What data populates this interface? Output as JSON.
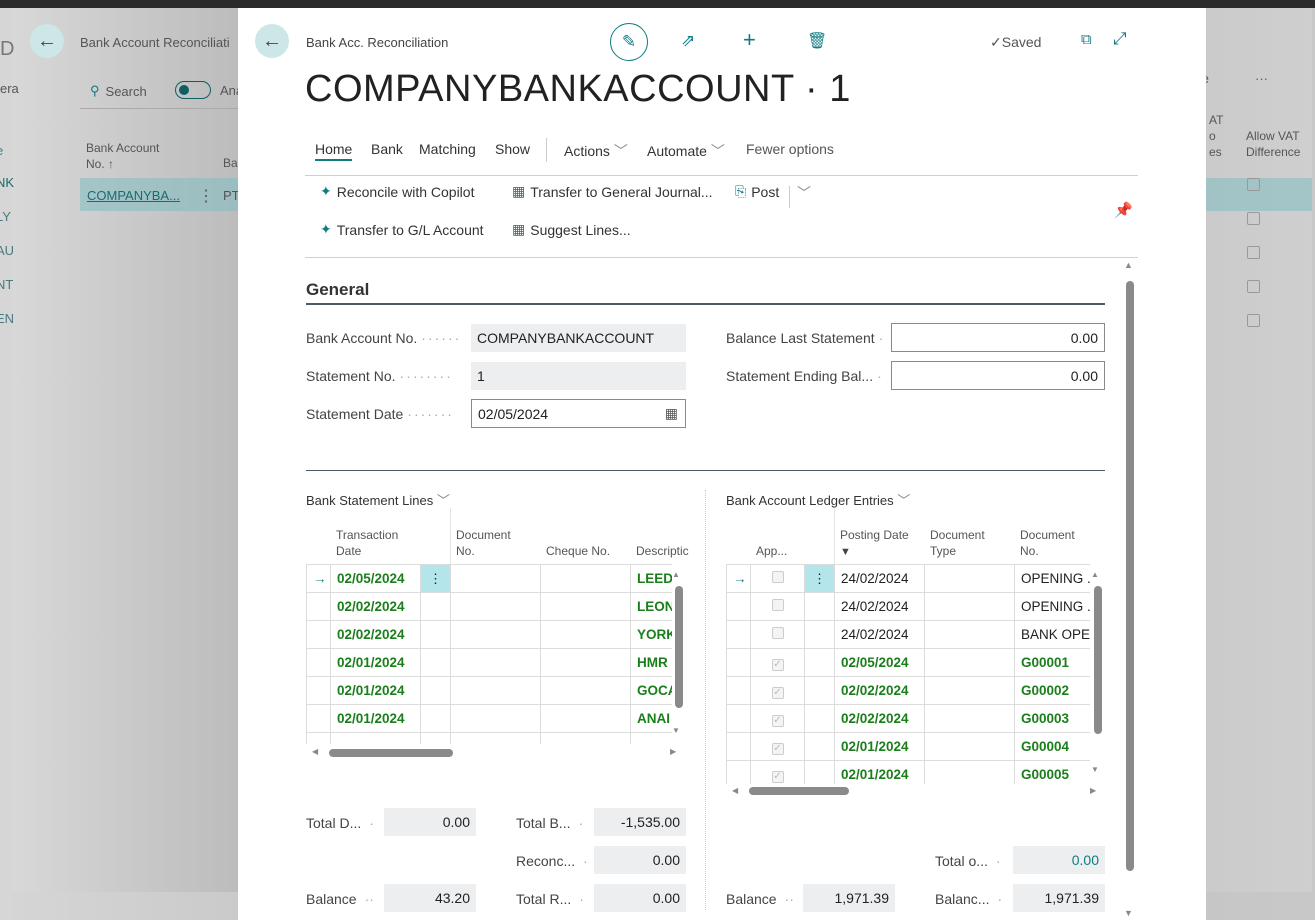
{
  "background": {
    "app_letter": "D",
    "page_title": "Bank Account Reconciliati",
    "search_label": "Search",
    "toggle_label": "Ana",
    "left_tab": "era",
    "col1": "Bank Account\nNo. ↑",
    "col2": "Ba",
    "row_value": "COMPANYBA...",
    "row_col2": "PT",
    "left_items": [
      "e",
      "NK",
      "LY",
      "AU",
      "NT",
      "EN"
    ],
    "right_action": "te",
    "more": "···",
    "col_vat": "AT\no\nes",
    "col_allow": "Allow VAT\nDifference"
  },
  "header": {
    "breadcrumb": "Bank Acc. Reconciliation",
    "title": "COMPANYBANKACCOUNT · 1",
    "saved": "Saved"
  },
  "tabs": [
    "Home",
    "Bank",
    "Matching",
    "Show",
    "Actions",
    "Automate",
    "Fewer options"
  ],
  "actions": {
    "reconcile": "Reconcile with Copilot",
    "transfer_journal": "Transfer to General Journal...",
    "post": "Post",
    "transfer_gl": "Transfer to G/L Account",
    "suggest": "Suggest Lines..."
  },
  "general": {
    "title": "General",
    "bank_account_label": "Bank Account No.",
    "bank_account": "COMPANYBANKACCOUNT",
    "statement_no_label": "Statement No.",
    "statement_no": "1",
    "statement_date_label": "Statement Date",
    "statement_date": "02/05/2024",
    "balance_last_label": "Balance Last Statement",
    "balance_last": "0.00",
    "ending_balance_label": "Statement Ending Bal...",
    "ending_balance": "0.00"
  },
  "statement_lines": {
    "title": "Bank Statement Lines",
    "headers": [
      "Transaction\nDate",
      "Document\nNo.",
      "Cheque No.",
      "Descriptic"
    ],
    "rows": [
      [
        "02/05/2024",
        "",
        "",
        "LEEDS"
      ],
      [
        "02/02/2024",
        "",
        "",
        "LEON"
      ],
      [
        "02/02/2024",
        "",
        "",
        "YORK"
      ],
      [
        "02/01/2024",
        "",
        "",
        "HMR"
      ],
      [
        "02/01/2024",
        "",
        "",
        "GOCA"
      ],
      [
        "02/01/2024",
        "",
        "",
        "ANAI"
      ]
    ]
  },
  "ledger_entries": {
    "title": "Bank Account Ledger Entries",
    "headers": [
      "App...",
      "Posting Date",
      "Document\nType",
      "Document\nNo."
    ],
    "rows": [
      {
        "applied": false,
        "date": "24/02/2024",
        "type": "",
        "doc": "OPENING ..",
        "bold": false
      },
      {
        "applied": false,
        "date": "24/02/2024",
        "type": "",
        "doc": "OPENING ..",
        "bold": false
      },
      {
        "applied": false,
        "date": "24/02/2024",
        "type": "",
        "doc": "BANK OPE.",
        "bold": false
      },
      {
        "applied": true,
        "date": "02/05/2024",
        "type": "",
        "doc": "G00001",
        "bold": true
      },
      {
        "applied": true,
        "date": "02/02/2024",
        "type": "",
        "doc": "G00002",
        "bold": true
      },
      {
        "applied": true,
        "date": "02/02/2024",
        "type": "",
        "doc": "G00003",
        "bold": true
      },
      {
        "applied": true,
        "date": "02/01/2024",
        "type": "",
        "doc": "G00004",
        "bold": true
      },
      {
        "applied": true,
        "date": "02/01/2024",
        "type": "",
        "doc": "G00005",
        "bold": true
      }
    ]
  },
  "totals": {
    "total_d_label": "Total D...",
    "total_d": "0.00",
    "total_b_label": "Total B...",
    "total_b": "-1,535.00",
    "reconc_label": "Reconc...",
    "reconc": "0.00",
    "balance_label": "Balance",
    "balance": "43.20",
    "total_r_label": "Total R...",
    "total_r": "0.00",
    "total_o_label": "Total o...",
    "total_o": "0.00",
    "ledger_balance_label": "Balance",
    "ledger_balance": "1,971.39",
    "balanc_label": "Balanc...",
    "balanc": "1,971.39"
  },
  "colors": {
    "accent": "#0f7b83",
    "applied_green": "#1a7f1a",
    "selected_cell": "#b3e5ea"
  }
}
